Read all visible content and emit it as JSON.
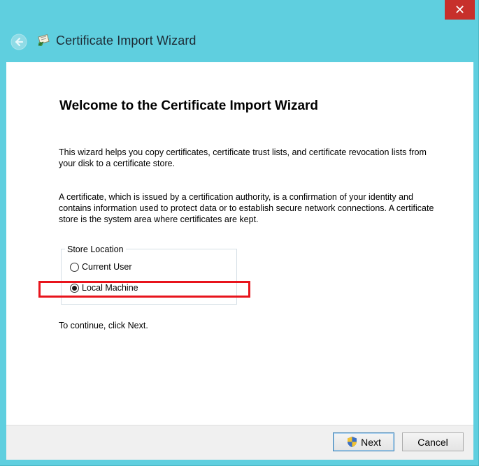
{
  "window": {
    "title": "Certificate Import Wizard",
    "close_glyph": "✕",
    "accent_color": "#5fcfdf"
  },
  "icons": {
    "back": "back-arrow-icon",
    "title": "certificate-icon",
    "close": "close-icon",
    "shield": "uac-shield-icon"
  },
  "content": {
    "heading": "Welcome to the Certificate Import Wizard",
    "paragraph1": "This wizard helps you copy certificates, certificate trust lists, and certificate revocation lists from your disk to a certificate store.",
    "paragraph2": "A certificate, which is issued by a certification authority, is a confirmation of your identity and contains information used to protect data or to establish secure network connections. A certificate store is the system area where certificates are kept.",
    "store_location": {
      "label": "Store Location",
      "options": [
        {
          "label": "Current User",
          "selected": false
        },
        {
          "label": "Local Machine",
          "selected": true
        }
      ]
    },
    "continue_text": "To continue, click Next."
  },
  "footer": {
    "next_label": "Next",
    "cancel_label": "Cancel"
  },
  "highlight_color": "#e8141c"
}
